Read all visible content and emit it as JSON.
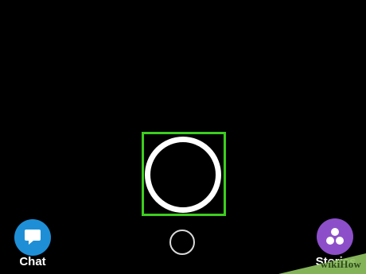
{
  "camera": {
    "capture_button": "shutter",
    "memories_button": "memories"
  },
  "bottom_nav": {
    "chat_label": "Chat",
    "chat_icon": "speech-bubble-icon",
    "stories_label": "Stories",
    "stories_icon": "three-circles-icon"
  },
  "watermark": {
    "text": "wikiHow"
  },
  "colors": {
    "background": "#000000",
    "highlight": "#3dce1f",
    "chat_accent": "#1e8fd6",
    "stories_accent": "#8c4fc9"
  }
}
